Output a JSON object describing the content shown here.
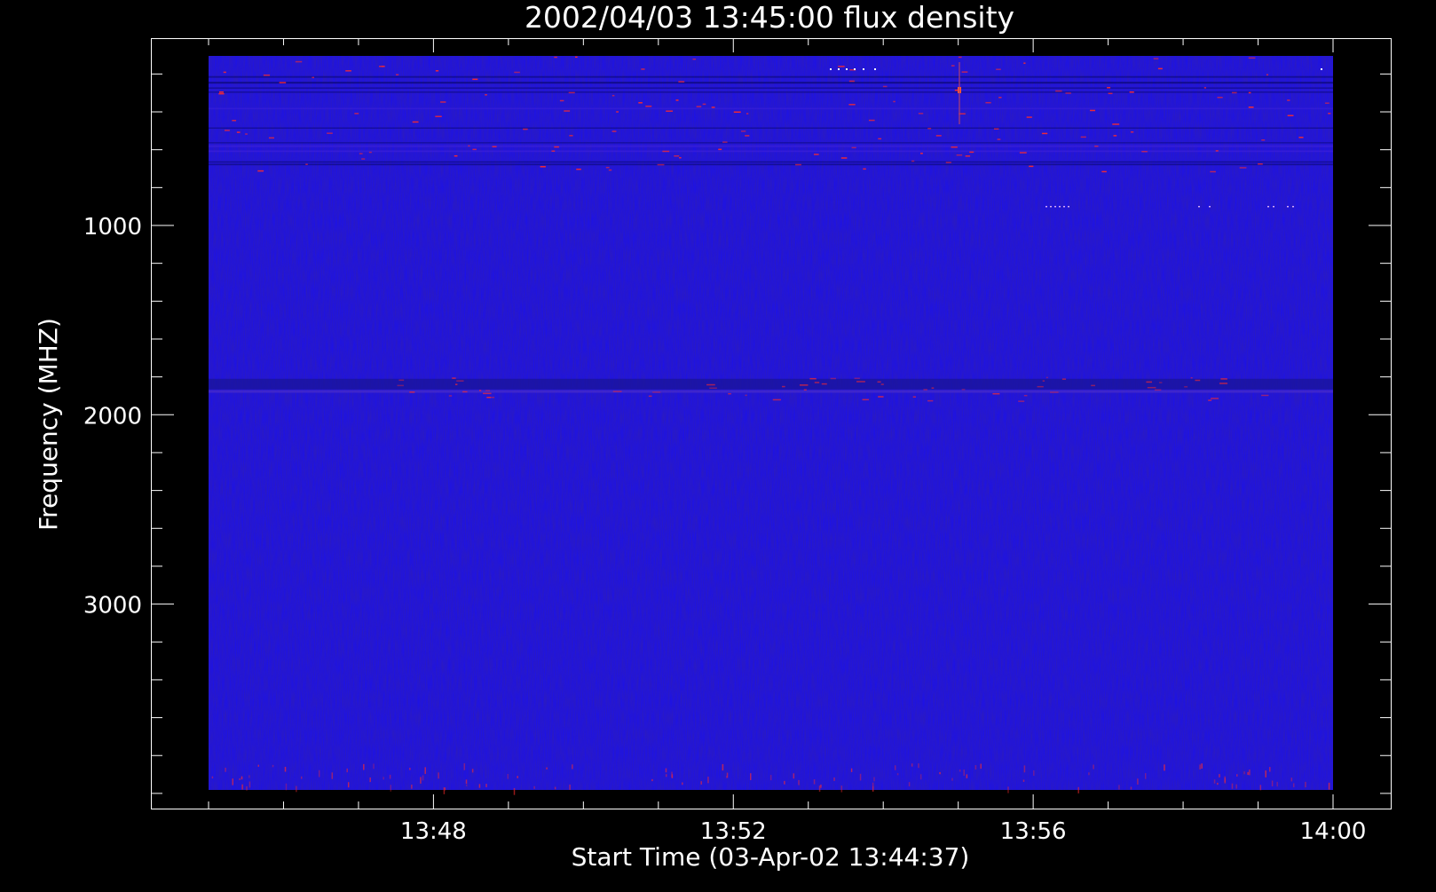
{
  "chart_data": {
    "type": "heatmap",
    "title": "2002/04/03 13:45:00 flux density",
    "xlabel": "Start Time (03-Apr-02 13:44:37)",
    "ylabel": "Frequency (MHZ)",
    "x_ticks": [
      {
        "label": "13:48",
        "minutes": 3.383
      },
      {
        "label": "13:52",
        "minutes": 7.383
      },
      {
        "label": "13:56",
        "minutes": 11.383
      },
      {
        "label": "14:00",
        "minutes": 15.383
      }
    ],
    "x_range_minutes": [
      0.383,
      15.383
    ],
    "y_ticks": [
      {
        "label": "1000",
        "value": 1000
      },
      {
        "label": "2000",
        "value": 2000
      },
      {
        "label": "3000",
        "value": 3000
      }
    ],
    "y_range": [
      0,
      4100
    ],
    "data_range_y": [
      100,
      4000
    ],
    "colors": {
      "background": "#000000",
      "axes": "#ffffff",
      "base": "#1a10ee",
      "base_dark": "#0c0ab8",
      "spot": "#ff2a2a",
      "hot": "#ffffff",
      "band": "#1a1498"
    },
    "features": [
      {
        "name": "dark band",
        "y_freq": 1830,
        "x_from": 0.4,
        "x_to": 15.3,
        "kind": "dark"
      },
      {
        "name": "speckle band",
        "y_freq": 1870,
        "x_from": 3.0,
        "x_to": 14.5,
        "kind": "spots"
      },
      {
        "name": "hot spot",
        "y_freq": 380,
        "x_from": 10.4,
        "x_to": 10.6,
        "kind": "hot"
      },
      {
        "name": "top interference",
        "y_freq": 400,
        "x_from": 0.4,
        "x_to": 15.3,
        "kind": "lines"
      }
    ]
  }
}
